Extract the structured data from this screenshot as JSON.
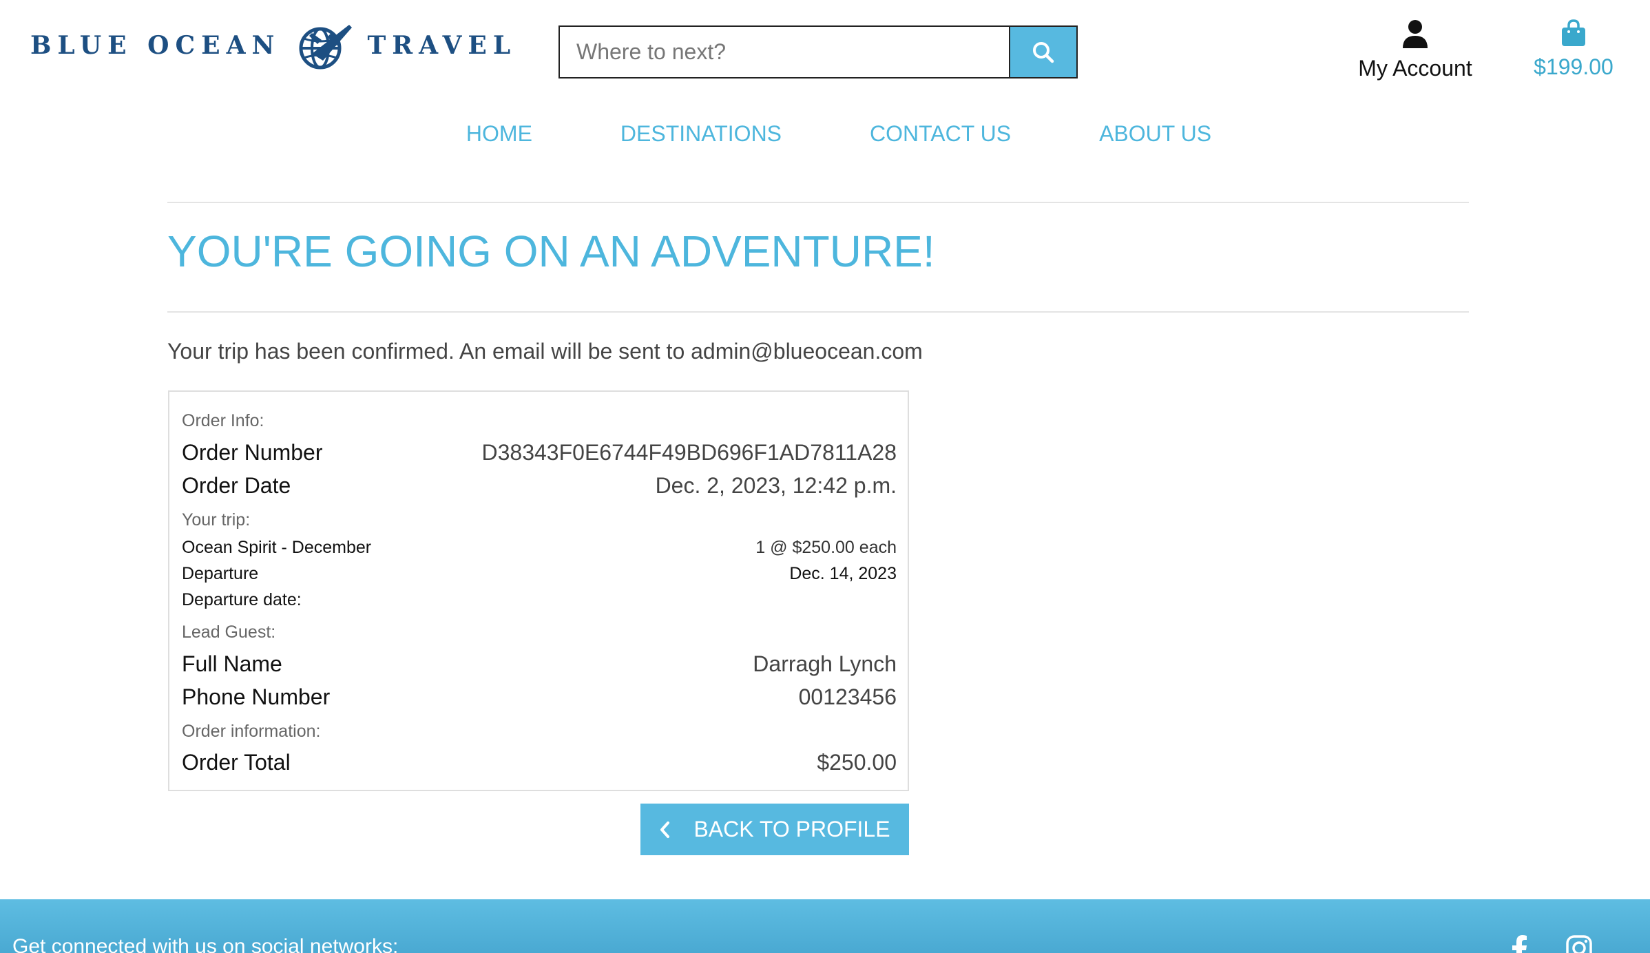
{
  "brand": {
    "word_left": "BLUE OCEAN",
    "word_right": "TRAVEL",
    "color": "#1d4f82"
  },
  "search": {
    "placeholder": "Where to next?",
    "button_icon": "search-icon"
  },
  "account": {
    "label": "My Account",
    "icon": "user-icon"
  },
  "cart": {
    "total": "$199.00",
    "icon": "shopping-bag-icon"
  },
  "nav": {
    "items": [
      {
        "label": "HOME"
      },
      {
        "label": "DESTINATIONS"
      },
      {
        "label": "CONTACT US"
      },
      {
        "label": "ABOUT US"
      }
    ]
  },
  "page": {
    "title": "YOU'RE GOING ON AN ADVENTURE!",
    "confirm_text": "Your trip has been confirmed. An email will be sent to admin@blueocean.com"
  },
  "order": {
    "info_label": "Order Info:",
    "number_label": "Order Number",
    "number_value": "D38343F0E6744F49BD696F1AD7811A28",
    "date_label": "Order Date",
    "date_value": "Dec. 2, 2023, 12:42 p.m.",
    "trip_label": "Your trip:",
    "trip_name_line1": "Ocean Spirit - December",
    "trip_name_line2": "Departure",
    "trip_qty": "1 @ $250.00 each",
    "departure_label": "Departure date:",
    "departure_value": "Dec. 14, 2023",
    "guest_label": "Lead Guest:",
    "fullname_label": "Full Name",
    "fullname_value": "Darragh Lynch",
    "phone_label": "Phone Number",
    "phone_value": "00123456",
    "info2_label": "Order information:",
    "total_label": "Order Total",
    "total_value": "$250.00"
  },
  "back_button": {
    "label": "BACK TO PROFILE",
    "icon": "chevron-left-icon"
  },
  "footer": {
    "text": "Get connected with us on social networks:",
    "icons": [
      "facebook-icon",
      "instagram-icon"
    ]
  },
  "colors": {
    "accent": "#57b9e0",
    "title": "#4db6dd",
    "brand": "#1d4f82"
  }
}
